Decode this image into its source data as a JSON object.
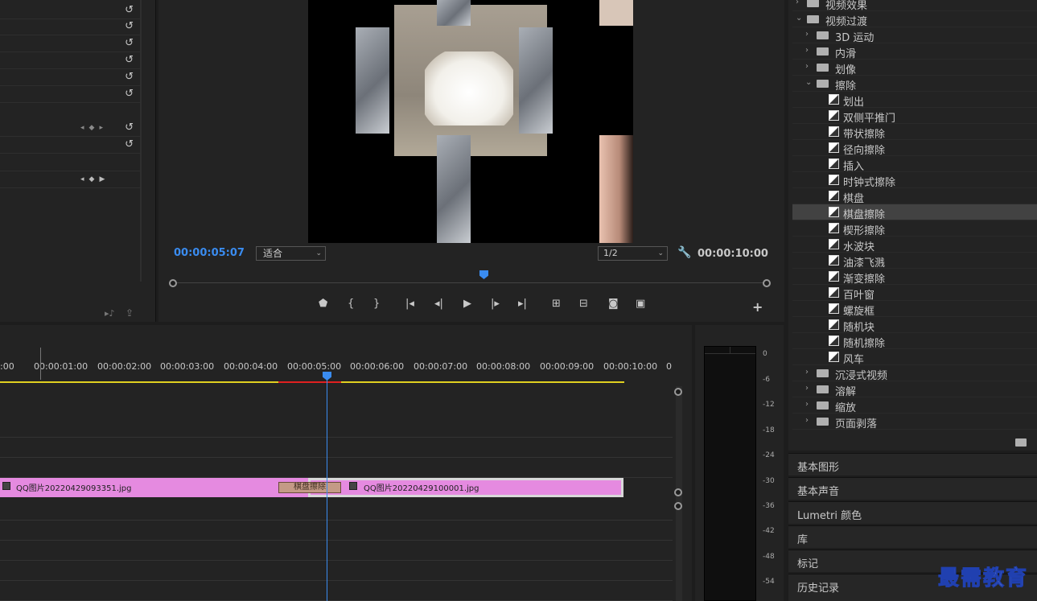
{
  "program_monitor": {
    "current_timecode": "00:00:05:07",
    "fit_label": "适合",
    "resolution": "1/2",
    "duration_timecode": "00:00:10:00"
  },
  "timeline": {
    "ruler_labels": [
      ":00",
      "00:00:01:00",
      "00:00:02:00",
      "00:00:03:00",
      "00:00:04:00",
      "00:00:05:00",
      "00:00:06:00",
      "00:00:07:00",
      "00:00:08:00",
      "00:00:09:00",
      "00:00:10:00",
      "0"
    ],
    "clip1_name": "QQ图片20220429093351.jpg",
    "clip2_name": "QQ图片20220429100001.jpg",
    "transition_name": "棋盘擦除"
  },
  "audio_meter": {
    "db_labels": [
      "0",
      "-6",
      "-12",
      "-18",
      "-24",
      "-30",
      "-36",
      "-42",
      "-48",
      "-54"
    ]
  },
  "effects": {
    "items": [
      {
        "label": "视频效果",
        "kind": "folder",
        "level": 0,
        "expanded": false
      },
      {
        "label": "视频过渡",
        "kind": "folder",
        "level": 0,
        "expanded": true
      },
      {
        "label": "3D 运动",
        "kind": "folder",
        "level": 1,
        "expanded": false
      },
      {
        "label": "内滑",
        "kind": "folder",
        "level": 1,
        "expanded": false
      },
      {
        "label": "划像",
        "kind": "folder",
        "level": 1,
        "expanded": false
      },
      {
        "label": "擦除",
        "kind": "folder",
        "level": 1,
        "expanded": true
      },
      {
        "label": "划出",
        "kind": "effect",
        "level": 2
      },
      {
        "label": "双侧平推门",
        "kind": "effect",
        "level": 2
      },
      {
        "label": "带状擦除",
        "kind": "effect",
        "level": 2
      },
      {
        "label": "径向擦除",
        "kind": "effect",
        "level": 2
      },
      {
        "label": "插入",
        "kind": "effect",
        "level": 2
      },
      {
        "label": "时钟式擦除",
        "kind": "effect",
        "level": 2
      },
      {
        "label": "棋盘",
        "kind": "effect",
        "level": 2
      },
      {
        "label": "棋盘擦除",
        "kind": "effect",
        "level": 2,
        "selected": true
      },
      {
        "label": "楔形擦除",
        "kind": "effect",
        "level": 2
      },
      {
        "label": "水波块",
        "kind": "effect",
        "level": 2
      },
      {
        "label": "油漆飞溅",
        "kind": "effect",
        "level": 2
      },
      {
        "label": "渐变擦除",
        "kind": "effect",
        "level": 2
      },
      {
        "label": "百叶窗",
        "kind": "effect",
        "level": 2
      },
      {
        "label": "螺旋框",
        "kind": "effect",
        "level": 2
      },
      {
        "label": "随机块",
        "kind": "effect",
        "level": 2
      },
      {
        "label": "随机擦除",
        "kind": "effect",
        "level": 2
      },
      {
        "label": "风车",
        "kind": "effect",
        "level": 2
      },
      {
        "label": "沉浸式视频",
        "kind": "folder",
        "level": 1,
        "expanded": false
      },
      {
        "label": "溶解",
        "kind": "folder",
        "level": 1,
        "expanded": false
      },
      {
        "label": "缩放",
        "kind": "folder",
        "level": 1,
        "expanded": false
      },
      {
        "label": "页面剥落",
        "kind": "folder",
        "level": 1,
        "expanded": false
      }
    ]
  },
  "panels": {
    "essential_graphics": "基本图形",
    "essential_sound": "基本声音",
    "lumetri": "Lumetri 颜色",
    "library": "库",
    "markers": "标记",
    "history": "历史记录"
  },
  "watermark": "最需教育",
  "colors": {
    "accent": "#3a8cf0",
    "clip": "#e58ae0",
    "transition": "#c49a86",
    "work_area": "#e0d020",
    "render_red": "#e02020"
  }
}
